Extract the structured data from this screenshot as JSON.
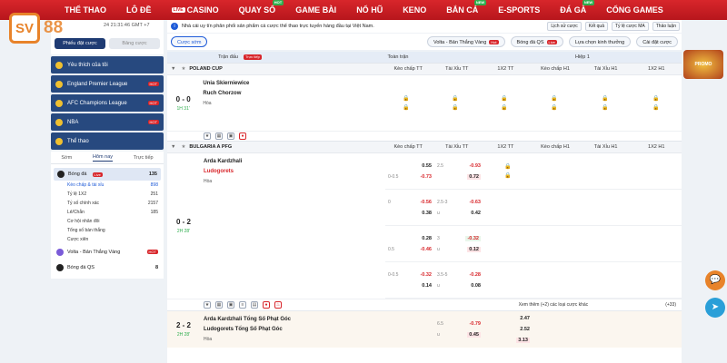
{
  "nav": {
    "logo_mark": "SV",
    "logo_num": "88",
    "items": [
      {
        "label": "THỂ THAO",
        "new": ""
      },
      {
        "label": "LÔ ĐỀ",
        "new": ""
      },
      {
        "label": "CASINO",
        "new": "",
        "live": "LIVE"
      },
      {
        "label": "QUAY SỐ",
        "new": "HOT"
      },
      {
        "label": "GAME BÀI",
        "new": ""
      },
      {
        "label": "NỔ HŨ",
        "new": ""
      },
      {
        "label": "KENO",
        "new": ""
      },
      {
        "label": "BẮN CÁ",
        "new": "NEW"
      },
      {
        "label": "E-SPORTS",
        "new": ""
      },
      {
        "label": "ĐÁ GÀ",
        "new": "NEW"
      },
      {
        "label": "CỔNG GAMES",
        "new": ""
      }
    ]
  },
  "left_header": {
    "time": "24 21:31:46 GMT +7",
    "tab_active": "Phiếu đặt cược",
    "tab_inactive": "Bảng cược"
  },
  "notice": {
    "icon": "i",
    "text": "Nhà cái uy tín phân phối sản phẩm cá cược thể thao trực tuyến hàng đầu tại Việt Nam.",
    "buttons": [
      "Lịch sử cược",
      "Kết quả",
      "Tỷ lệ cược MA",
      "Thảo luận"
    ]
  },
  "filter": {
    "bet_label": "Cược sớm",
    "volta_label": "Volta - Bản Thắng Vàng",
    "volta_badge": "Hot",
    "bongda_label": "Bóng đá QS",
    "bongda_badge": "Live",
    "select_label": "Lựa chọn kinh thưởng",
    "settings_label": "Cài đặt cược"
  },
  "sidebar": {
    "top_items": [
      {
        "label": "Yêu thích của tôi",
        "hot": ""
      },
      {
        "label": "England Premier League",
        "hot": "HOT"
      },
      {
        "label": "AFC Champions League",
        "hot": "HOT"
      },
      {
        "label": "NBA",
        "hot": "HOT"
      },
      {
        "label": "Thể thao",
        "hot": ""
      }
    ],
    "subtabs": [
      "Sớm",
      "Hôm nay",
      "Trực tiếp"
    ],
    "sport": {
      "label": "Bóng đá",
      "live": "Live",
      "count": "135"
    },
    "sub_items": [
      {
        "label": "Kèo chấp & tài xỉu",
        "count": "898"
      },
      {
        "label": "Tỷ lệ 1X2",
        "count": "251"
      },
      {
        "label": "Tỷ số chính xác",
        "count": "2157"
      },
      {
        "label": "Lẻ/Chẵn",
        "count": "185"
      },
      {
        "label": "Cơ hội nhân đôi",
        "count": ""
      },
      {
        "label": "Tổng số bàn thắng",
        "count": ""
      },
      {
        "label": "Cược xiên",
        "count": ""
      }
    ],
    "bottom_items": [
      {
        "label": "Volta - Bản Thắng Vàng",
        "hot": "HOT",
        "count": ""
      },
      {
        "label": "Bóng đá QS",
        "hot": "",
        "count": "8"
      }
    ]
  },
  "table": {
    "header": {
      "match": "Trận đấu",
      "live_tag": "Trực tiếp",
      "full": "Toàn trận",
      "half": "Hiệp 1"
    },
    "columns": [
      "Kèo chấp TT",
      "Tài Xỉu TT",
      "1X2 TT",
      "Kèo chấp H1",
      "Tài Xỉu H1",
      "1X2 H1"
    ],
    "leagues": [
      {
        "name": "POLAND CUP",
        "matches": [
          {
            "score": "0 - 0",
            "clock": "1H 31'",
            "home": "Unia Skierniewice",
            "away": "Ruch Chorzow",
            "draw": "Hòa"
          }
        ]
      },
      {
        "name": "BULGARIA A PFG",
        "matches": [
          {
            "score": "0 - 2",
            "clock": "2H 28'",
            "home": "Arda Kardzhali",
            "away": "Ludogorets",
            "draw": "Hòa",
            "rows": [
              {
                "hc": [
                  "",
                  "0.55",
                  "0-0.5",
                  "-0.73"
                ],
                "ou": [
                  "2.5",
                  "-0.93",
                  "",
                  "0.72"
                ]
              },
              {
                "hc": [
                  "0",
                  "-0.56",
                  "",
                  "0.38"
                ],
                "ou": [
                  "2.5-3",
                  "-0.63",
                  "u",
                  "0.42"
                ]
              },
              {
                "hc": [
                  "",
                  "0.28",
                  "0.5",
                  "-0.46"
                ],
                "ou": [
                  "3",
                  "-0.32",
                  "u",
                  "0.12"
                ]
              },
              {
                "hc": [
                  "0-0.5",
                  "-0.32",
                  "",
                  "0.14"
                ],
                "ou": [
                  "3.5-5",
                  "-0.28",
                  "u",
                  "0.08"
                ]
              }
            ],
            "more": "Xem thêm (+2) các loại cược khác",
            "more_count": "(+33)"
          },
          {
            "score": "2 - 2",
            "clock": "2H 28'",
            "home": "Arda Kardzhali Tổng Số Phạt Góc",
            "away": "Ludogorets Tổng Số Phạt Góc",
            "draw": "Hòa",
            "ou": [
              "6.5",
              "-0.79",
              "u",
              "0.45"
            ],
            "x12": [
              "2.47",
              "2.52",
              "3.13"
            ]
          }
        ]
      }
    ]
  },
  "floating": {
    "promo": "PROMO",
    "chat": "💬",
    "telegram": "➤"
  }
}
